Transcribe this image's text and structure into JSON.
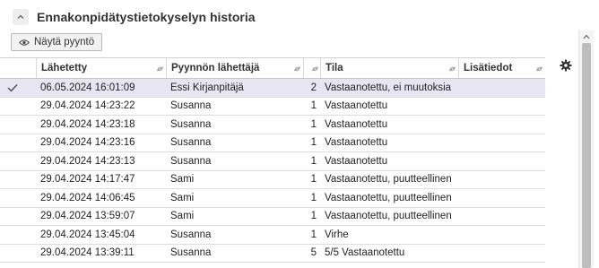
{
  "section": {
    "title": "Ennakonpidätystietokyselyn historia"
  },
  "toolbar": {
    "show_request_label": "Näytä pyyntö"
  },
  "table": {
    "columns": [
      "Lähetetty",
      "Pyynnön lähettäjä",
      "",
      "Tila",
      "Lisätiedot"
    ],
    "rows": [
      {
        "selected": true,
        "sent": "06.05.2024 16:01:09",
        "sender": "Essi Kirjanpitäjä",
        "count": "2",
        "status": "Vastaanotettu, ei muutoksia",
        "info": ""
      },
      {
        "selected": false,
        "sent": "29.04.2024 14:23:22",
        "sender": "Susanna",
        "count": "1",
        "status": "Vastaanotettu",
        "info": ""
      },
      {
        "selected": false,
        "sent": "29.04.2024 14:23:18",
        "sender": "Susanna",
        "count": "1",
        "status": "Vastaanotettu",
        "info": ""
      },
      {
        "selected": false,
        "sent": "29.04.2024 14:23:16",
        "sender": "Susanna",
        "count": "1",
        "status": "Vastaanotettu",
        "info": ""
      },
      {
        "selected": false,
        "sent": "29.04.2024 14:23:13",
        "sender": "Susanna",
        "count": "1",
        "status": "Vastaanotettu",
        "info": ""
      },
      {
        "selected": false,
        "sent": "29.04.2024 14:17:47",
        "sender": "Sami",
        "count": "1",
        "status": "Vastaanotettu, puutteellinen",
        "info": ""
      },
      {
        "selected": false,
        "sent": "29.04.2024 14:06:45",
        "sender": "Sami",
        "count": "1",
        "status": "Vastaanotettu, puutteellinen",
        "info": ""
      },
      {
        "selected": false,
        "sent": "29.04.2024 13:59:07",
        "sender": "Sami",
        "count": "1",
        "status": "Vastaanotettu, puutteellinen",
        "info": ""
      },
      {
        "selected": false,
        "sent": "29.04.2024 13:45:04",
        "sender": "Susanna",
        "count": "1",
        "status": "Virhe",
        "info": ""
      },
      {
        "selected": false,
        "sent": "29.04.2024 13:39:11",
        "sender": "Susanna",
        "count": "5",
        "status": "5/5 Vastaanotettu",
        "info": ""
      }
    ]
  },
  "icons": {
    "collapse": "chevron-up-icon",
    "eye": "eye-icon",
    "check": "check-icon",
    "settings": "gear-icon",
    "sort": "sort-icon"
  },
  "colors": {
    "selected_row": "#e9e6f3",
    "scroll_thumb": "#bdbdbd"
  }
}
